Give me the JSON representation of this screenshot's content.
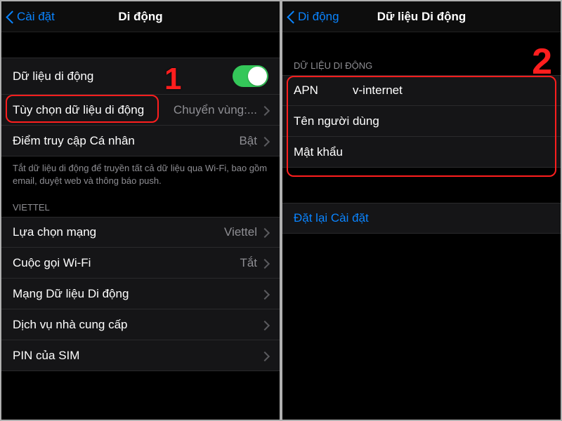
{
  "left": {
    "nav": {
      "back": "Cài đặt",
      "title": "Di động"
    },
    "annotation": "1",
    "rows": {
      "mobile_data": {
        "label": "Dữ liệu di động",
        "toggle": "on"
      },
      "options": {
        "label": "Tùy chọn dữ liệu di động",
        "value": "Chuyển vùng:..."
      },
      "hotspot": {
        "label": "Điểm truy cập Cá nhân",
        "value": "Bật"
      }
    },
    "footer": "Tắt dữ liệu di động để truyền tất cả dữ liệu qua Wi-Fi, bao gồm email, duyệt web và thông báo push.",
    "carrier_section": "VIETTEL",
    "carrier_rows": {
      "network_select": {
        "label": "Lựa chọn mạng",
        "value": "Viettel"
      },
      "wifi_calling": {
        "label": "Cuộc gọi Wi-Fi",
        "value": "Tắt"
      },
      "data_network": {
        "label": "Mạng Dữ liệu Di động"
      },
      "carrier_services": {
        "label": "Dịch vụ nhà cung cấp"
      },
      "sim_pin": {
        "label": "PIN của SIM"
      }
    }
  },
  "right": {
    "nav": {
      "back": "Di động",
      "title": "Dữ liệu Di động"
    },
    "annotation": "2",
    "section": "DỮ LIỆU DI ĐỘNG",
    "fields": {
      "apn": {
        "label": "APN",
        "value": "v-internet"
      },
      "username": {
        "label": "Tên người dùng",
        "value": ""
      },
      "password": {
        "label": "Mật khẩu",
        "value": ""
      }
    },
    "reset": "Đặt lại Cài đặt"
  }
}
